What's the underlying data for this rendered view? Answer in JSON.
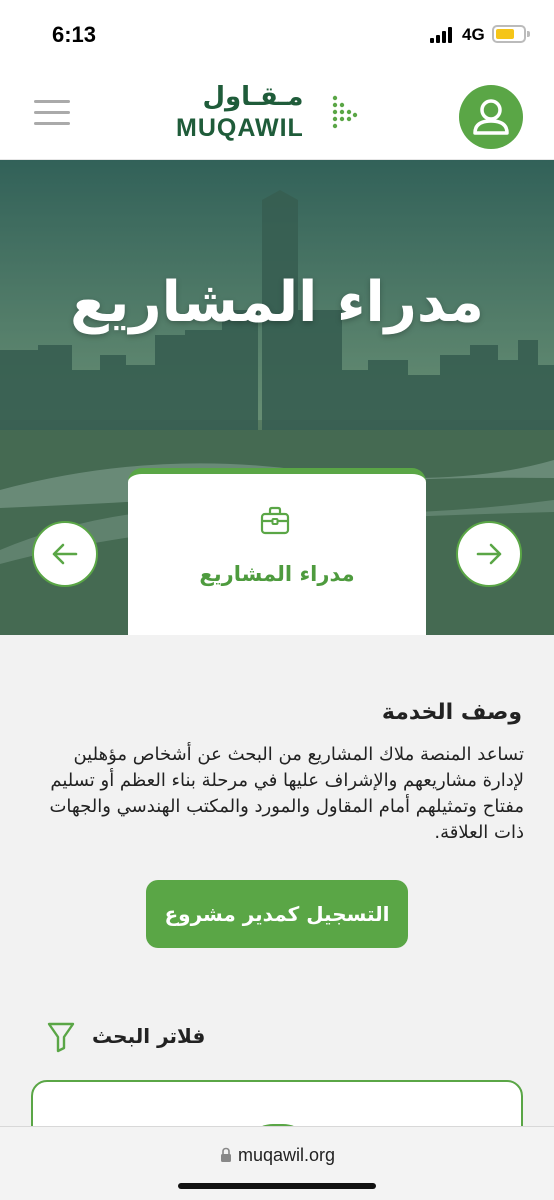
{
  "status_bar": {
    "time": "6:13",
    "network": "4G"
  },
  "header": {
    "logo_ar": "مـقـاول",
    "logo_en": "MUQAWIL",
    "menu_icon": "hamburger-icon",
    "profile_icon": "user-icon"
  },
  "hero": {
    "title": "مدراء المشاريع"
  },
  "service_card": {
    "label": "مدراء المشاريع",
    "icon": "briefcase-icon"
  },
  "description": {
    "title": "وصف الخدمة",
    "text": "تساعد المنصة ملاك المشاريع من البحث عن أشخاص مؤهلين لإدارة مشاريعهم والإشراف عليها في مرحلة بناء العظم أو تسليم مفتاح وتمثيلهم أمام المقاول والمورد والمكتب الهندسي والجهات ذات العلاقة."
  },
  "register_button": {
    "label": "التسجيل كمدير مشروع"
  },
  "filters": {
    "label": "فلاتر البحث",
    "icon": "funnel-icon"
  },
  "browser": {
    "url": "muqawil.org"
  },
  "colors": {
    "brand_green": "#5aa646",
    "logo_dark_green": "#1f5c3a"
  }
}
